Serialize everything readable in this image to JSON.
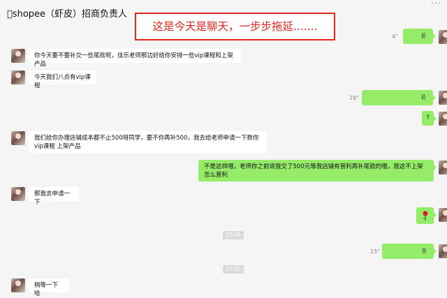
{
  "header": {
    "title": "\u0000shopee（虾皮）招商负责人",
    "more_label": "..."
  },
  "annotation": {
    "text": "这是今天是聊天，一步步拖延.......",
    "color": "#e1261c"
  },
  "colors": {
    "background": "#f5f5f5",
    "outgoing_bubble": "#95ec69",
    "incoming_bubble": "#ffffff",
    "timestamp_pill": "#dadada"
  },
  "messages": {
    "m1": {
      "duration": "4\"",
      "voice_icon": "voice-wave-icon"
    },
    "m2": {
      "text": "你今天要不要补交一些尾款呢，佳乐老师那边好给你安排一些vip课程和上架产品"
    },
    "m3": {
      "text": "今天我们八点有vip课程"
    },
    "m4": {
      "duration": "28\"",
      "voice_icon": "voice-wave-icon"
    },
    "m5": {
      "text": "?"
    },
    "m6": {
      "text": "我们给你办理店铺成本都不止500呀同学，要不你再补500，我去给老师申请一下数你vip课程 上架产品"
    },
    "m7": {
      "text": "不是这样哦，老师你之前说我交了500元等我店铺有营利再补尾款的哦，我这不上架怎么营利"
    },
    "m8": {
      "text": "那我去申请一下"
    },
    "m9": {
      "emoji": "rose-icon"
    },
    "t1": {
      "text": "15:36"
    },
    "m10": {
      "duration": "15\"",
      "voice_icon": "voice-wave-icon"
    },
    "t2": {
      "text": "15:42"
    },
    "m11": {
      "text": "稍等一下哈"
    }
  }
}
